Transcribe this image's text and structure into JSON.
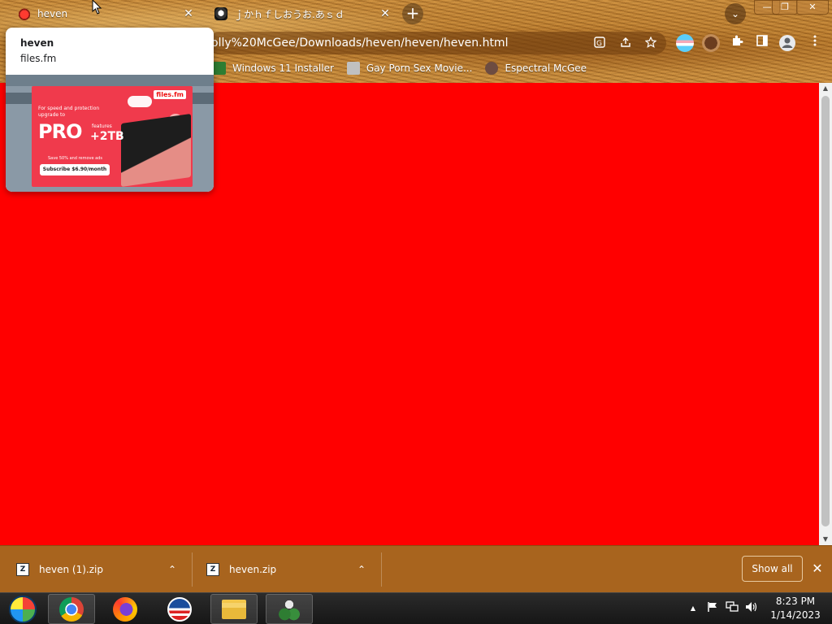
{
  "tabs": [
    {
      "title": "heven",
      "close": "✕"
    },
    {
      "title": "ｊかｈｆしおうお.あｓｄ",
      "close": "✕"
    }
  ],
  "new_tab_glyph": "+",
  "tab_search_glyph": "⌄",
  "window_controls": {
    "minimize": "—",
    "maximize": "❐",
    "close": "✕"
  },
  "omnibox": {
    "url": "olly%20McGee/Downloads/heven/heven/heven.html",
    "icons": [
      "translate-icon",
      "share-icon",
      "star-icon"
    ]
  },
  "bookmarks": [
    {
      "label": "Windows 11 Installer",
      "icon": "windows-installer-icon",
      "color": "#2e7d32"
    },
    {
      "label": "Gay Porn Sex Movie...",
      "icon": "site-icon",
      "color": "#c0c0c0"
    },
    {
      "label": "Espectral McGee",
      "icon": "avatar-icon",
      "color": "#6d4c41"
    }
  ],
  "hover_card": {
    "title": "heven",
    "domain": "files.fm",
    "ad": {
      "brand": "files.fm",
      "tagline": "For speed and protection upgrade to",
      "pro": "PRO",
      "features": "features",
      "storage": "+2TB",
      "save": "Save 50% and remove ads",
      "button": "Subscribe $6.90/month"
    }
  },
  "page": {
    "background": "#ff0000"
  },
  "downloads": [
    {
      "name": "heven (1).zip",
      "icon": "Z"
    },
    {
      "name": "heven.zip",
      "icon": "Z"
    }
  ],
  "shelf": {
    "show_all": "Show all",
    "close": "✕",
    "chevron": "⌃"
  },
  "taskbar": {
    "apps": [
      "start-orb",
      "chrome",
      "firefox",
      "obama",
      "file-explorer",
      "plant"
    ],
    "tray_arrow": "▲",
    "clock_time": "8:23 PM",
    "clock_date": "1/14/2023"
  }
}
